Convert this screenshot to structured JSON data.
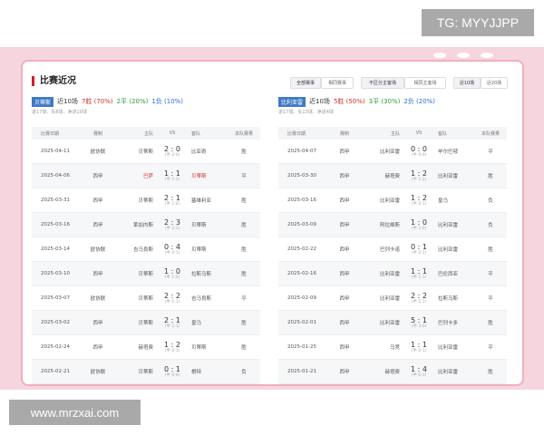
{
  "watermark": "TG: MYYJJPP",
  "footer_url": "www.mrzxai.com",
  "section_title": "比赛近况",
  "filters": {
    "group1": [
      "全部赛事",
      "相同赛事"
    ],
    "group2": [
      "不区分主客场",
      "相同主客场"
    ],
    "group3": [
      "近10场",
      "近20场"
    ]
  },
  "colors": {
    "accent_red": "#d0312d",
    "tag_blue": "#3f79c6",
    "pink": "#f6d5df"
  },
  "left": {
    "team": "贝蒂斯",
    "recent": "近10场",
    "wins": "7胜 (70%)",
    "draws": "2平 (20%)",
    "losses": "1负 (10%)",
    "sub": "进17球、失8球、净进10球",
    "headers": [
      "比赛日期",
      "赛制",
      "主队",
      "VS",
      "客队",
      "本队赛果"
    ],
    "rows": [
      {
        "date": "2025-04-11",
        "comp": "欧协联",
        "home": "贝蒂斯",
        "score": "2 : 0",
        "ht": "(半 2:0)",
        "away": "比亚奇",
        "res": "胜",
        "home_red": false,
        "away_red": false
      },
      {
        "date": "2025-04-06",
        "comp": "西甲",
        "home": "巴萨",
        "score": "1 : 1",
        "ht": "(半 1:1)",
        "away": "贝蒂斯",
        "res": "平",
        "home_red": true,
        "away_red": true
      },
      {
        "date": "2025-03-31",
        "comp": "西甲",
        "home": "贝蒂斯",
        "score": "2 : 1",
        "ht": "(半 1:0)",
        "away": "塞维利亚",
        "res": "胜",
        "home_red": false,
        "away_red": false
      },
      {
        "date": "2025-03-16",
        "comp": "西甲",
        "home": "莱加内斯",
        "score": "2 : 3",
        "ht": "(半 2:1)",
        "away": "贝蒂斯",
        "res": "胜",
        "home_red": false,
        "away_red": false
      },
      {
        "date": "2025-03-14",
        "comp": "欧协联",
        "home": "吉马良斯",
        "score": "0 : 4",
        "ht": "(半 0:1)",
        "away": "贝蒂斯",
        "res": "胜",
        "home_red": false,
        "away_red": false
      },
      {
        "date": "2025-03-10",
        "comp": "西甲",
        "home": "贝蒂斯",
        "score": "1 : 0",
        "ht": "(半 1:0)",
        "away": "拉斯马斯",
        "res": "胜",
        "home_red": false,
        "away_red": false
      },
      {
        "date": "2025-03-07",
        "comp": "欧协联",
        "home": "贝蒂斯",
        "score": "2 : 2",
        "ht": "(半 1:1)",
        "away": "吉马良斯",
        "res": "平",
        "home_red": false,
        "away_red": false
      },
      {
        "date": "2025-03-02",
        "comp": "西甲",
        "home": "贝蒂斯",
        "score": "2 : 1",
        "ht": "(半 1:1)",
        "away": "皇马",
        "res": "胜",
        "home_red": false,
        "away_red": false
      },
      {
        "date": "2025-02-24",
        "comp": "西甲",
        "home": "赫塔费",
        "score": "1 : 2",
        "ht": "(半 0:1)",
        "away": "贝蒂斯",
        "res": "胜",
        "home_red": false,
        "away_red": false
      },
      {
        "date": "2025-02-21",
        "comp": "欧协联",
        "home": "贝蒂斯",
        "score": "0 : 1",
        "ht": "(半 0:0)",
        "away": "根特",
        "res": "负",
        "home_red": false,
        "away_red": false
      }
    ]
  },
  "right": {
    "team": "比利亚雷",
    "recent": "近10场",
    "wins": "5胜 (50%)",
    "draws": "3平 (30%)",
    "losses": "2负 (20%)",
    "sub": "进17球、失13球、净进4球",
    "headers": [
      "比赛日期",
      "赛制",
      "主队",
      "VS",
      "客队",
      "本队赛果"
    ],
    "rows": [
      {
        "date": "2025-04-07",
        "comp": "西甲",
        "home": "比利亚雷",
        "score": "0 : 0",
        "ht": "(半 0:0)",
        "away": "毕尔巴鄂",
        "res": "平",
        "home_red": false,
        "away_red": false
      },
      {
        "date": "2025-03-30",
        "comp": "西甲",
        "home": "赫塔费",
        "score": "1 : 2",
        "ht": "(半 1:2)",
        "away": "比利亚雷",
        "res": "胜",
        "home_red": false,
        "away_red": false
      },
      {
        "date": "2025-03-16",
        "comp": "西甲",
        "home": "比利亚雷",
        "score": "1 : 2",
        "ht": "(半 0:1)",
        "away": "皇马",
        "res": "负",
        "home_red": false,
        "away_red": false
      },
      {
        "date": "2025-03-09",
        "comp": "西甲",
        "home": "阿拉维斯",
        "score": "1 : 0",
        "ht": "(半 1:0)",
        "away": "比利亚雷",
        "res": "负",
        "home_red": false,
        "away_red": false
      },
      {
        "date": "2025-02-22",
        "comp": "西甲",
        "home": "巴列卡诺",
        "score": "0 : 1",
        "ht": "(半 0:1)",
        "away": "比利亚雷",
        "res": "胜",
        "home_red": false,
        "away_red": false
      },
      {
        "date": "2025-02-16",
        "comp": "西甲",
        "home": "比利亚雷",
        "score": "1 : 1",
        "ht": "(半 1:1)",
        "away": "巴伦西亚",
        "res": "平",
        "home_red": false,
        "away_red": false
      },
      {
        "date": "2025-02-09",
        "comp": "西甲",
        "home": "比利亚雷",
        "score": "2 : 2",
        "ht": "(半 1:1)",
        "away": "拉斯马斯",
        "res": "平",
        "home_red": false,
        "away_red": false
      },
      {
        "date": "2025-02-01",
        "comp": "西甲",
        "home": "比利亚雷",
        "score": "5 : 1",
        "ht": "(半 3:0)",
        "away": "巴列卡多",
        "res": "胜",
        "home_red": false,
        "away_red": false
      },
      {
        "date": "2025-01-25",
        "comp": "西甲",
        "home": "马竞",
        "score": "1 : 1",
        "ht": "(半 0:1)",
        "away": "比利亚雷",
        "res": "平",
        "home_red": false,
        "away_red": false
      },
      {
        "date": "2025-01-21",
        "comp": "西甲",
        "home": "赫塔费",
        "score": "1 : 4",
        "ht": "(半 0:1)",
        "away": "比利亚雷",
        "res": "胜",
        "home_red": false,
        "away_red": false
      }
    ]
  }
}
